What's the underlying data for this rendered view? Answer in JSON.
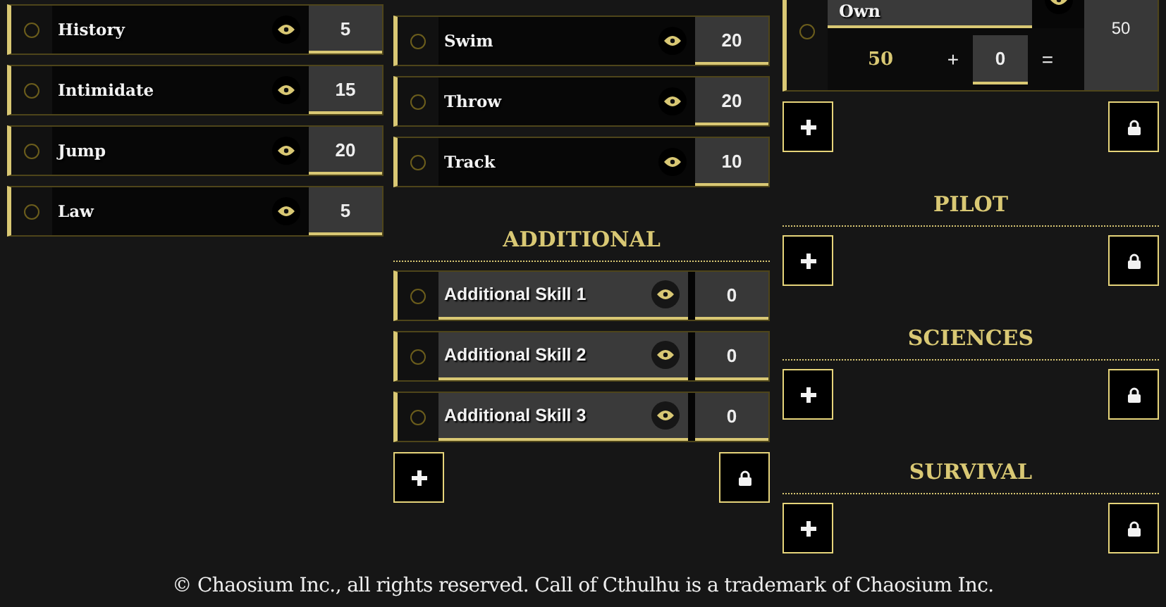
{
  "columns": [
    {
      "sections": [
        {
          "skills": [
            {
              "kind": "standard",
              "name": "History",
              "value": "5",
              "checked": false
            },
            {
              "kind": "standard",
              "name": "Intimidate",
              "value": "15",
              "checked": false
            },
            {
              "kind": "standard",
              "name": "Jump",
              "value": "20",
              "checked": false
            },
            {
              "kind": "standard",
              "name": "Law",
              "value": "5",
              "checked": false
            }
          ]
        }
      ]
    },
    {
      "sections": [
        {
          "skills": [
            {
              "kind": "standard",
              "name": "Swim",
              "value": "20",
              "checked": false
            },
            {
              "kind": "standard",
              "name": "Throw",
              "value": "20",
              "checked": false
            },
            {
              "kind": "standard",
              "name": "Track",
              "value": "10",
              "checked": false
            }
          ]
        },
        {
          "title": "ADDITIONAL",
          "actions": [
            {
              "kind": "add"
            },
            {
              "kind": "lock"
            }
          ],
          "skills": [
            {
              "kind": "custom",
              "name": "Additional Skill 1",
              "value": "0",
              "checked": false
            },
            {
              "kind": "custom",
              "name": "Additional Skill 2",
              "value": "0",
              "checked": false
            },
            {
              "kind": "custom",
              "name": "Additional Skill 3",
              "value": "0",
              "checked": false
            }
          ]
        }
      ]
    },
    {
      "sections": [
        {
          "actions": [
            {
              "kind": "add"
            },
            {
              "kind": "lock"
            }
          ],
          "skills": [
            {
              "kind": "specialty",
              "name": "Own",
              "value": "50",
              "base": "50",
              "plus": "+",
              "bonus": "0",
              "equals": "=",
              "checked": false
            }
          ]
        },
        {
          "title": "PILOT",
          "actions": [
            {
              "kind": "add"
            },
            {
              "kind": "lock"
            }
          ]
        },
        {
          "title": "SCIENCES",
          "actions": [
            {
              "kind": "add"
            },
            {
              "kind": "lock"
            }
          ]
        },
        {
          "title": "SURVIVAL",
          "actions": [
            {
              "kind": "add"
            },
            {
              "kind": "lock"
            }
          ]
        }
      ]
    }
  ],
  "footer": "© Chaosium Inc., all rights reserved. Call of Cthulhu is a trademark of Chaosium Inc."
}
